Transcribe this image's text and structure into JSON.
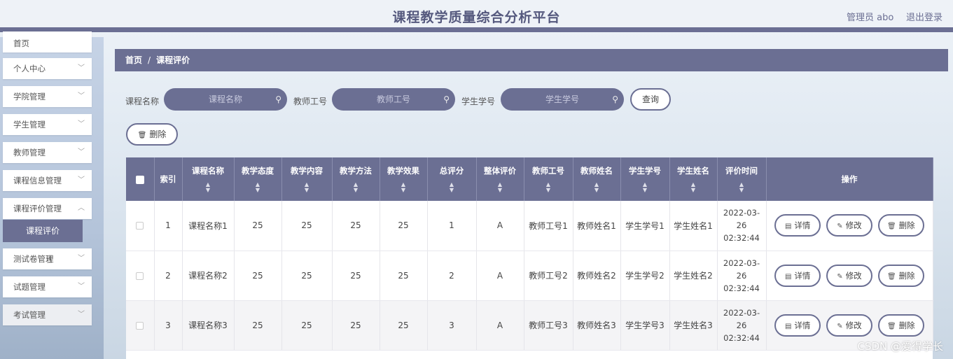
{
  "header": {
    "title": "课程教学质量综合分析平台",
    "user": "管理员 abo",
    "logout": "退出登录"
  },
  "sidebar": {
    "items": [
      {
        "label": "首页"
      },
      {
        "label": "个人中心"
      },
      {
        "label": "学院管理"
      },
      {
        "label": "学生管理"
      },
      {
        "label": "教师管理"
      },
      {
        "label": "课程信息管理"
      },
      {
        "label": "课程评价管理"
      },
      {
        "label": "测试卷管理"
      },
      {
        "label": "试题管理"
      },
      {
        "label": "考试管理"
      }
    ],
    "active_sub": "课程评价"
  },
  "breadcrumb": {
    "home": "首页",
    "sep": "/",
    "current": "课程评价"
  },
  "search": {
    "course_label": "课程名称",
    "course_placeholder": "课程名称",
    "teacher_label": "教师工号",
    "teacher_placeholder": "教师工号",
    "student_label": "学生学号",
    "student_placeholder": "学生学号",
    "query_button": "查询",
    "delete_button": "删除"
  },
  "table": {
    "columns": [
      "索引",
      "课程名称",
      "教学态度",
      "教学内容",
      "教学方法",
      "教学效果",
      "总评分",
      "整体评价",
      "教师工号",
      "教师姓名",
      "学生学号",
      "学生姓名",
      "评价时间",
      "操作"
    ],
    "rows": [
      {
        "index": "1",
        "course": "课程名称1",
        "attitude": "25",
        "content": "25",
        "method": "25",
        "effect": "25",
        "total": "1",
        "overall": "A",
        "teacher_id": "教师工号1",
        "teacher_name": "教师姓名1",
        "student_id": "学生学号1",
        "student_name": "学生姓名1",
        "time": "2022-03-26 02:32:44"
      },
      {
        "index": "2",
        "course": "课程名称2",
        "attitude": "25",
        "content": "25",
        "method": "25",
        "effect": "25",
        "total": "2",
        "overall": "A",
        "teacher_id": "教师工号2",
        "teacher_name": "教师姓名2",
        "student_id": "学生学号2",
        "student_name": "学生姓名2",
        "time": "2022-03-26 02:32:44"
      },
      {
        "index": "3",
        "course": "课程名称3",
        "attitude": "25",
        "content": "25",
        "method": "25",
        "effect": "25",
        "total": "3",
        "overall": "A",
        "teacher_id": "教师工号3",
        "teacher_name": "教师姓名3",
        "student_id": "学生学号3",
        "student_name": "学生姓名3",
        "time": "2022-03-26 02:32:44"
      }
    ],
    "actions": {
      "detail": "详情",
      "edit": "修改",
      "delete": "删除"
    }
  },
  "watermark": "CSDN @爱得学长",
  "colors": {
    "accent": "#6b6f93"
  }
}
